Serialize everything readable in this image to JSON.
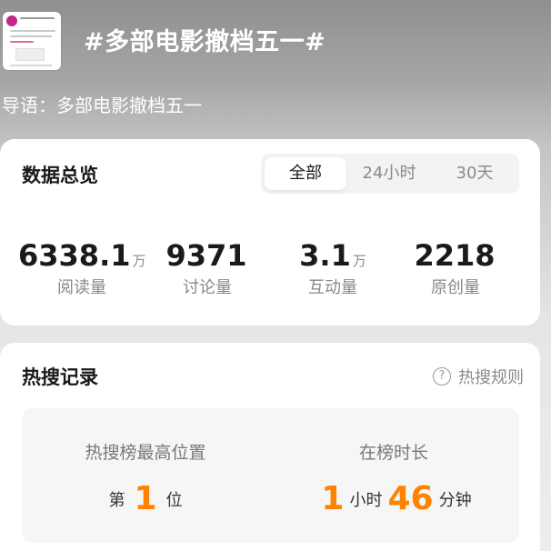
{
  "topic": {
    "title": "#多部电影撤档五一#",
    "guide": "导语：多部电影撤档五一"
  },
  "overview": {
    "title": "数据总览",
    "tabs": [
      {
        "label": "全部",
        "active": true
      },
      {
        "label": "24小时",
        "active": false
      },
      {
        "label": "30天",
        "active": false
      }
    ],
    "stats": [
      {
        "value": "6338.1",
        "unit": "万",
        "label": "阅读量"
      },
      {
        "value": "9371",
        "unit": "",
        "label": "讨论量"
      },
      {
        "value": "3.1",
        "unit": "万",
        "label": "互动量"
      },
      {
        "value": "2218",
        "unit": "",
        "label": "原创量"
      }
    ]
  },
  "hot_search": {
    "title": "热搜记录",
    "rules_label": "热搜规则",
    "rules_icon": "question-circle-icon",
    "highest": {
      "label": "热搜榜最高位置",
      "prefix": "第",
      "position": "1",
      "suffix": "位"
    },
    "duration": {
      "label": "在榜时长",
      "hours": "1",
      "hours_unit": "小时",
      "minutes": "46",
      "minutes_unit": "分钟"
    }
  },
  "colors": {
    "accent": "#ff8200",
    "card": "#ffffff",
    "muted": "#8a8a8a"
  }
}
